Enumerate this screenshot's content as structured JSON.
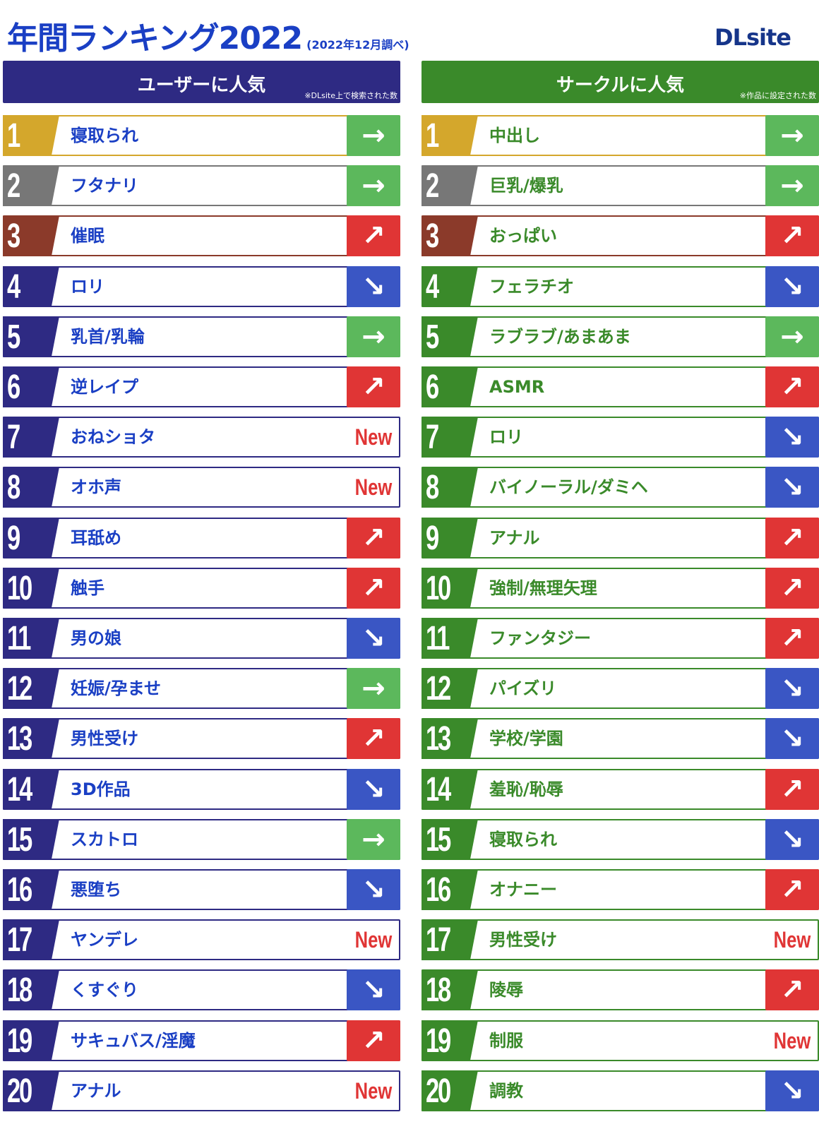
{
  "header": {
    "title": "年間ランキング2022",
    "subtitle": "(2022年12月調べ)",
    "logo": "DLsite"
  },
  "colors": {
    "user_accent": "#2e2a83",
    "circle_accent": "#3a8a2a",
    "gold": "#d4a72c",
    "silver": "#777777",
    "bronze": "#8b3a2a",
    "trend_same": "#5cb85c",
    "trend_up": "#e03535",
    "trend_down": "#3a56c4",
    "new_text": "#e03535"
  },
  "trend_symbols": {
    "same": "→",
    "up": "↗",
    "down": "↘",
    "new": "New"
  },
  "columns": [
    {
      "title": "ユーザーに人気",
      "note": "※DLsite上で検索された数",
      "items": [
        {
          "rank": "1",
          "label": "寝取られ",
          "trend": "same"
        },
        {
          "rank": "2",
          "label": "フタナリ",
          "trend": "same"
        },
        {
          "rank": "3",
          "label": "催眠",
          "trend": "up"
        },
        {
          "rank": "4",
          "label": "ロリ",
          "trend": "down"
        },
        {
          "rank": "5",
          "label": "乳首/乳輪",
          "trend": "same"
        },
        {
          "rank": "6",
          "label": "逆レイプ",
          "trend": "up"
        },
        {
          "rank": "7",
          "label": "おねショタ",
          "trend": "new"
        },
        {
          "rank": "8",
          "label": "オホ声",
          "trend": "new"
        },
        {
          "rank": "9",
          "label": "耳舐め",
          "trend": "up"
        },
        {
          "rank": "10",
          "label": "触手",
          "trend": "up"
        },
        {
          "rank": "11",
          "label": "男の娘",
          "trend": "down"
        },
        {
          "rank": "12",
          "label": "妊娠/孕ませ",
          "trend": "same"
        },
        {
          "rank": "13",
          "label": "男性受け",
          "trend": "up"
        },
        {
          "rank": "14",
          "label": "3D作品",
          "trend": "down"
        },
        {
          "rank": "15",
          "label": "スカトロ",
          "trend": "same"
        },
        {
          "rank": "16",
          "label": "悪堕ち",
          "trend": "down"
        },
        {
          "rank": "17",
          "label": "ヤンデレ",
          "trend": "new"
        },
        {
          "rank": "18",
          "label": "くすぐり",
          "trend": "down"
        },
        {
          "rank": "19",
          "label": "サキュバス/淫魔",
          "trend": "up"
        },
        {
          "rank": "20",
          "label": "アナル",
          "trend": "new"
        }
      ]
    },
    {
      "title": "サークルに人気",
      "note": "※作品に設定された数",
      "items": [
        {
          "rank": "1",
          "label": "中出し",
          "trend": "same"
        },
        {
          "rank": "2",
          "label": "巨乳/爆乳",
          "trend": "same"
        },
        {
          "rank": "3",
          "label": "おっぱい",
          "trend": "up"
        },
        {
          "rank": "4",
          "label": "フェラチオ",
          "trend": "down"
        },
        {
          "rank": "5",
          "label": "ラブラブ/あまあま",
          "trend": "same"
        },
        {
          "rank": "6",
          "label": "ASMR",
          "trend": "up"
        },
        {
          "rank": "7",
          "label": "ロリ",
          "trend": "down"
        },
        {
          "rank": "8",
          "label": "バイノーラル/ダミヘ",
          "trend": "down"
        },
        {
          "rank": "9",
          "label": "アナル",
          "trend": "up"
        },
        {
          "rank": "10",
          "label": "強制/無理矢理",
          "trend": "up"
        },
        {
          "rank": "11",
          "label": "ファンタジー",
          "trend": "up"
        },
        {
          "rank": "12",
          "label": "パイズリ",
          "trend": "down"
        },
        {
          "rank": "13",
          "label": "学校/学園",
          "trend": "down"
        },
        {
          "rank": "14",
          "label": "羞恥/恥辱",
          "trend": "up"
        },
        {
          "rank": "15",
          "label": "寝取られ",
          "trend": "down"
        },
        {
          "rank": "16",
          "label": "オナニー",
          "trend": "up"
        },
        {
          "rank": "17",
          "label": "男性受け",
          "trend": "new"
        },
        {
          "rank": "18",
          "label": "陵辱",
          "trend": "up"
        },
        {
          "rank": "19",
          "label": "制服",
          "trend": "new"
        },
        {
          "rank": "20",
          "label": "調教",
          "trend": "down"
        }
      ]
    }
  ]
}
